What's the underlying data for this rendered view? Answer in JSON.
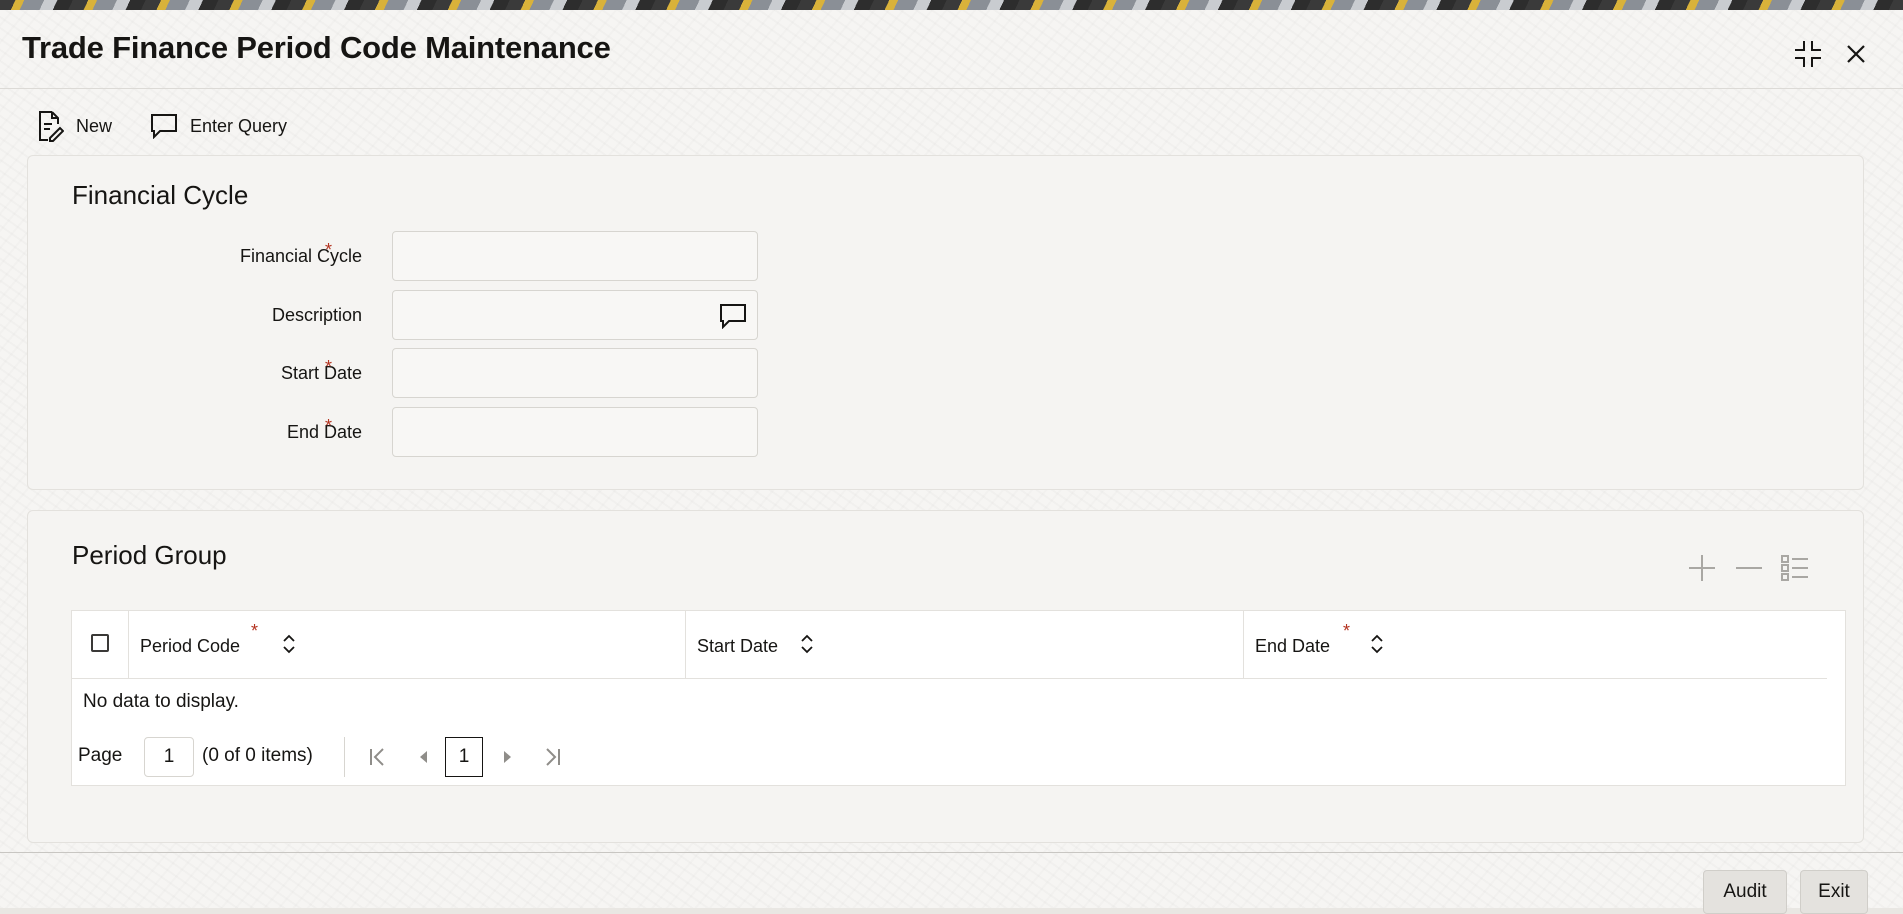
{
  "window": {
    "title": "Trade Finance Period Code Maintenance"
  },
  "toolbar": {
    "new_label": "New",
    "enter_query_label": "Enter Query"
  },
  "financial_cycle_section": {
    "heading": "Financial Cycle",
    "fields": {
      "financial_cycle": {
        "label": "Financial Cycle",
        "value": "",
        "required": true
      },
      "description": {
        "label": "Description",
        "value": ""
      },
      "start_date": {
        "label": "Start Date",
        "value": "",
        "required": true
      },
      "end_date": {
        "label": "End Date",
        "value": "",
        "required": true
      }
    },
    "required_marker": "*"
  },
  "period_group_section": {
    "heading": "Period Group",
    "columns": [
      {
        "label": "Period Code",
        "required": true
      },
      {
        "label": "Start Date",
        "required": false
      },
      {
        "label": "End Date",
        "required": true
      }
    ],
    "rows": [],
    "empty_message": "No data to display.",
    "pager": {
      "page_label": "Page",
      "page_value": "1",
      "items_summary": "(0 of 0 items)",
      "current_page": "1"
    }
  },
  "footer": {
    "audit_label": "Audit",
    "exit_label": "Exit"
  },
  "colors": {
    "required": "#b3321f",
    "panel_background": "#f5f4f2",
    "text": "#161513"
  },
  "icons": [
    "new-document-icon",
    "chat-bubble-icon",
    "minimize-icon",
    "close-icon",
    "add-row-icon",
    "delete-row-icon",
    "list-view-icon",
    "sort-icon",
    "first-page-icon",
    "prev-page-icon",
    "next-page-icon",
    "last-page-icon"
  ]
}
